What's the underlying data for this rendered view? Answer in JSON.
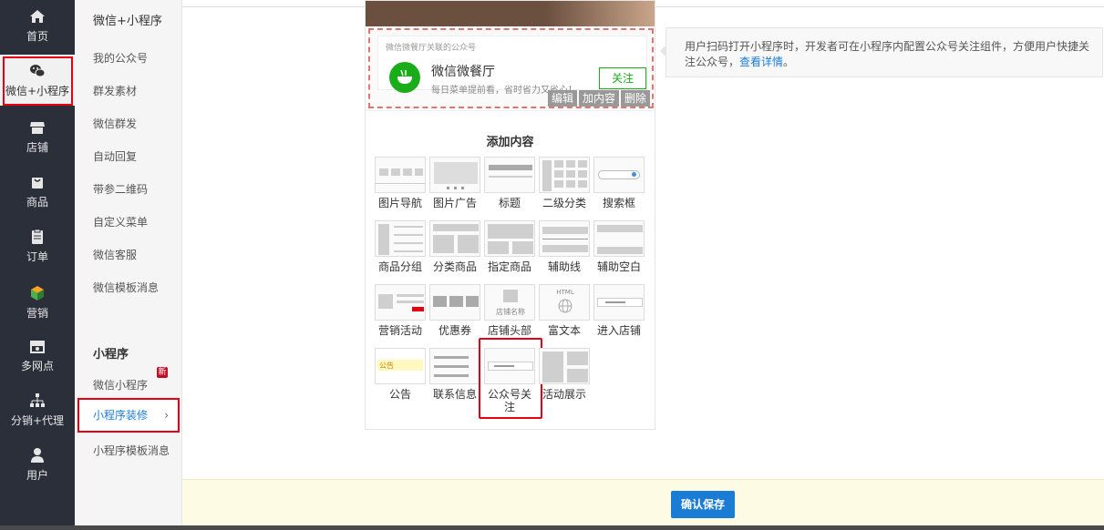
{
  "nav": {
    "items": [
      {
        "label": "首页",
        "icon": "home-icon"
      },
      {
        "label": "微信+小程序",
        "icon": "wechat-icon"
      },
      {
        "label": "店铺",
        "icon": "store-icon"
      },
      {
        "label": "商品",
        "icon": "bag-icon"
      },
      {
        "label": "订单",
        "icon": "order-icon"
      },
      {
        "label": "营销",
        "icon": "cube-icon"
      },
      {
        "label": "多网点",
        "icon": "branch-store-icon"
      },
      {
        "label": "分销+代理",
        "icon": "hierarchy-icon"
      },
      {
        "label": "用户",
        "icon": "user-icon"
      }
    ]
  },
  "submenu": {
    "title": "微信+小程序",
    "items": [
      "我的公众号",
      "群发素材",
      "微信群发",
      "自动回复",
      "带参二维码",
      "自定义菜单",
      "微信客服",
      "微信模板消息"
    ],
    "section2_title": "小程序",
    "items2": [
      "微信小程序",
      "小程序装修",
      "小程序模板消息"
    ],
    "new_badge": "新",
    "active_arrow": "›"
  },
  "follow": {
    "note": "微信微餐厅关联的公众号",
    "name": "微信微餐厅",
    "desc": "每日菜单提前看，省时省力又省心！",
    "btn": "关注",
    "ops": [
      "编辑",
      "加内容",
      "删除"
    ]
  },
  "add": {
    "title": "添加内容",
    "tiles": [
      "图片导航",
      "图片广告",
      "标题",
      "二级分类",
      "搜索框",
      "商品分组",
      "分类商品",
      "指定商品",
      "辅助线",
      "辅助空白",
      "营销活动",
      "优惠券",
      "店铺头部",
      "富文本",
      "进入店铺",
      "公告",
      "联系信息",
      "公众号关注",
      "活动展示"
    ],
    "notice_text": "公告",
    "store_name_text": "店铺名称",
    "html_text": "HTML"
  },
  "info": {
    "text": "用户扫码打开小程序时，开发者可在小程序内配置公众号关注组件，方便用户快捷关注公众号，",
    "link": "查看详情",
    "tail": "。"
  },
  "footer": {
    "save": "确认保存"
  }
}
